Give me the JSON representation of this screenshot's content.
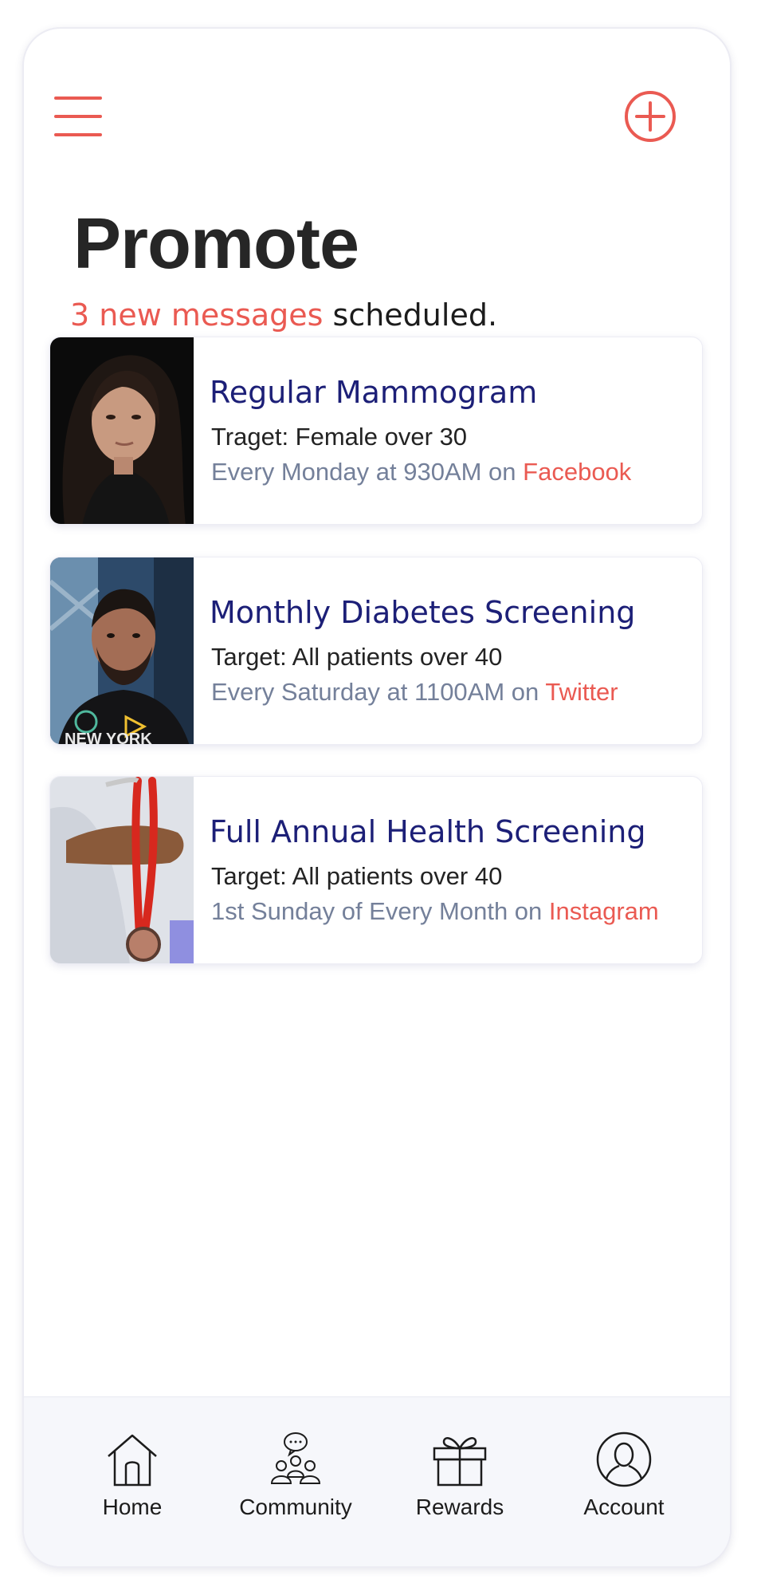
{
  "header": {
    "title": "Promote",
    "subtitle_count": "3 new messages",
    "subtitle_rest": " scheduled."
  },
  "colors": {
    "accent": "#ea5a52",
    "card_title": "#1c1f77",
    "schedule_text": "#74809a",
    "text_dark": "#232323"
  },
  "messages": [
    {
      "title": "Regular Mammogram",
      "target": "Traget: Female over 30",
      "schedule": "Every Monday at 930AM on ",
      "platform": "Facebook",
      "photo": "portrait-woman-dark-background"
    },
    {
      "title": "Monthly Diabetes Screening",
      "target": "Target: All patients over 40",
      "schedule": "Every Saturday at 1100AM on ",
      "platform": "Twitter",
      "photo": "portrait-man-new-york-shirt"
    },
    {
      "title": "Full Annual Health Screening",
      "target": "Target: All patients over 40",
      "schedule": "1st Sunday of Every Month on ",
      "platform": "Instagram",
      "photo": "hand-holding-red-stethoscope"
    }
  ],
  "tabbar": {
    "items": [
      {
        "label": "Home",
        "icon": "home-icon"
      },
      {
        "label": "Community",
        "icon": "community-icon"
      },
      {
        "label": "Rewards",
        "icon": "gift-icon"
      },
      {
        "label": "Account",
        "icon": "account-icon"
      }
    ]
  }
}
